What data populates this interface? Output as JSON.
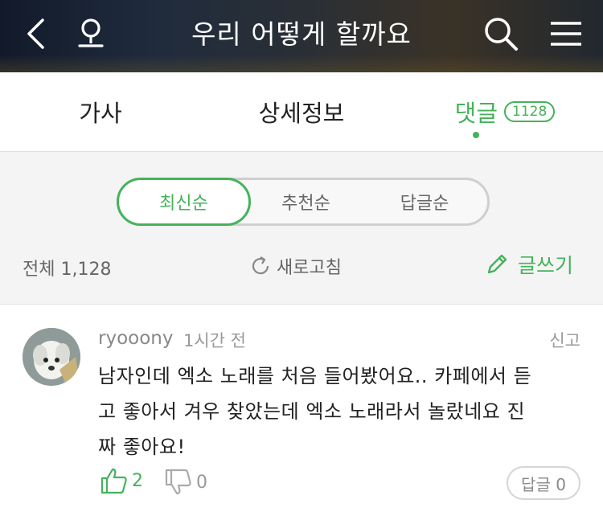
{
  "header": {
    "title": "우리 어떻게 할까요"
  },
  "tabs": [
    {
      "label": "가사"
    },
    {
      "label": "상세정보"
    },
    {
      "label": "댓글",
      "count": "1128"
    }
  ],
  "sort": {
    "options": [
      "최신순",
      "추천순",
      "답글순"
    ],
    "selected": "최신순"
  },
  "summary": {
    "total": "전체 1,128",
    "refresh": "새로고침",
    "write": "글쓰기"
  },
  "comment": {
    "username": "ryooony",
    "time": "1시간 전",
    "report": "신고",
    "lines": [
      "남자인데 엑소 노래를 처음 들어봤어요.. 카페에서 듣",
      "고 좋아서 겨우 찾았는데 엑소 노래라서 놀랐네요 진",
      "짜 좋아요!"
    ],
    "likes": "2",
    "dislikes": "0",
    "reply": "답글 0"
  },
  "colors": {
    "accent": "#44b35a"
  },
  "icons": [
    "back-icon",
    "voice-search-icon",
    "search-icon",
    "menu-icon",
    "refresh-icon",
    "pencil-icon",
    "thumbs-up-icon",
    "thumbs-down-icon"
  ]
}
